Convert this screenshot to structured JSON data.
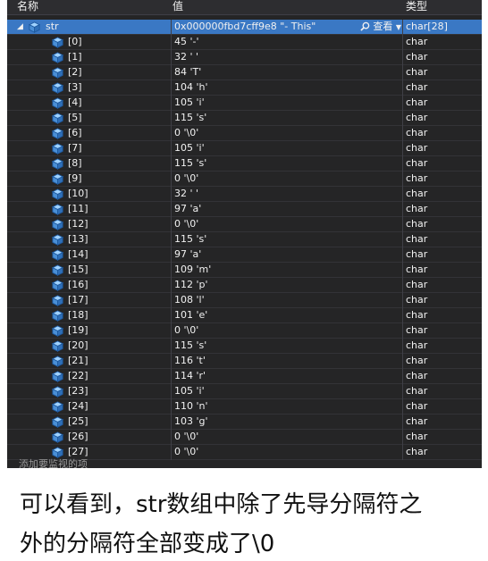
{
  "watch": {
    "headers": {
      "name": "名称",
      "value": "值",
      "type": "类型"
    },
    "root": {
      "name": "str",
      "value": "0x000000fbd7cff9e8 \"- This\"",
      "viewer_label": "查看",
      "type": "char[28]"
    },
    "items": [
      {
        "name": "[0]",
        "value": "45 '-'",
        "type": "char"
      },
      {
        "name": "[1]",
        "value": "32 ' '",
        "type": "char"
      },
      {
        "name": "[2]",
        "value": "84 'T'",
        "type": "char"
      },
      {
        "name": "[3]",
        "value": "104 'h'",
        "type": "char"
      },
      {
        "name": "[4]",
        "value": "105 'i'",
        "type": "char"
      },
      {
        "name": "[5]",
        "value": "115 's'",
        "type": "char"
      },
      {
        "name": "[6]",
        "value": "0 '\\0'",
        "type": "char"
      },
      {
        "name": "[7]",
        "value": "105 'i'",
        "type": "char"
      },
      {
        "name": "[8]",
        "value": "115 's'",
        "type": "char"
      },
      {
        "name": "[9]",
        "value": "0 '\\0'",
        "type": "char"
      },
      {
        "name": "[10]",
        "value": "32 ' '",
        "type": "char"
      },
      {
        "name": "[11]",
        "value": "97 'a'",
        "type": "char"
      },
      {
        "name": "[12]",
        "value": "0 '\\0'",
        "type": "char"
      },
      {
        "name": "[13]",
        "value": "115 's'",
        "type": "char"
      },
      {
        "name": "[14]",
        "value": "97 'a'",
        "type": "char"
      },
      {
        "name": "[15]",
        "value": "109 'm'",
        "type": "char"
      },
      {
        "name": "[16]",
        "value": "112 'p'",
        "type": "char"
      },
      {
        "name": "[17]",
        "value": "108 'l'",
        "type": "char"
      },
      {
        "name": "[18]",
        "value": "101 'e'",
        "type": "char"
      },
      {
        "name": "[19]",
        "value": "0 '\\0'",
        "type": "char"
      },
      {
        "name": "[20]",
        "value": "115 's'",
        "type": "char"
      },
      {
        "name": "[21]",
        "value": "116 't'",
        "type": "char"
      },
      {
        "name": "[22]",
        "value": "114 'r'",
        "type": "char"
      },
      {
        "name": "[23]",
        "value": "105 'i'",
        "type": "char"
      },
      {
        "name": "[24]",
        "value": "110 'n'",
        "type": "char"
      },
      {
        "name": "[25]",
        "value": "103 'g'",
        "type": "char"
      },
      {
        "name": "[26]",
        "value": "0 '\\0'",
        "type": "char"
      },
      {
        "name": "[27]",
        "value": "0 '\\0'",
        "type": "char"
      }
    ],
    "add_watch_placeholder": "添加要监视的项"
  },
  "caption": {
    "line1": "可以看到，str数组中除了先导分隔符之",
    "line2": "外的分隔符全部变成了\\0"
  },
  "colors": {
    "panel_bg": "#252526",
    "header_bg": "#2d2d30",
    "selected_row": "#3a78c4",
    "text": "#f1f1f1",
    "icon": "#75beff"
  }
}
